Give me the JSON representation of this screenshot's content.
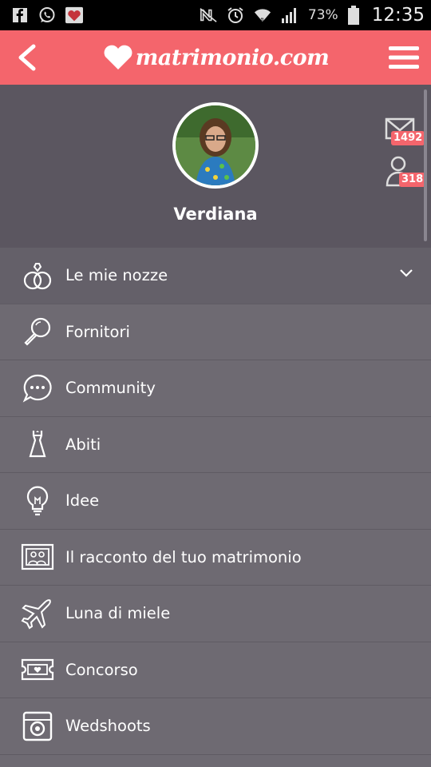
{
  "status_bar": {
    "battery": "73%",
    "time": "12:35",
    "icons": [
      "facebook-icon",
      "whatsapp-icon",
      "matrimonio-notif-icon",
      "nfc-icon",
      "alarm-icon",
      "wifi-icon",
      "signal-icon",
      "battery-icon"
    ]
  },
  "header": {
    "brand": "matrimonio.com",
    "back_icon": "chevron-left-icon",
    "menu_icon": "hamburger-icon",
    "brand_color": "#f4656c"
  },
  "profile": {
    "name": "Verdiana",
    "messages_count": "1492",
    "friends_count": "318"
  },
  "menu": {
    "items": [
      {
        "label": "Le mie nozze",
        "icon": "rings-icon"
      },
      {
        "label": "Fornitori",
        "icon": "magnifier-icon"
      },
      {
        "label": "Community",
        "icon": "chat-bubble-icon"
      },
      {
        "label": "Abiti",
        "icon": "dress-icon"
      },
      {
        "label": "Idee",
        "icon": "lightbulb-icon"
      },
      {
        "label": "Il racconto del tuo matrimonio",
        "icon": "photo-album-icon"
      },
      {
        "label": "Luna di miele",
        "icon": "airplane-icon"
      },
      {
        "label": "Concorso",
        "icon": "ticket-icon"
      },
      {
        "label": "Wedshoots",
        "icon": "camera-icon"
      }
    ]
  }
}
